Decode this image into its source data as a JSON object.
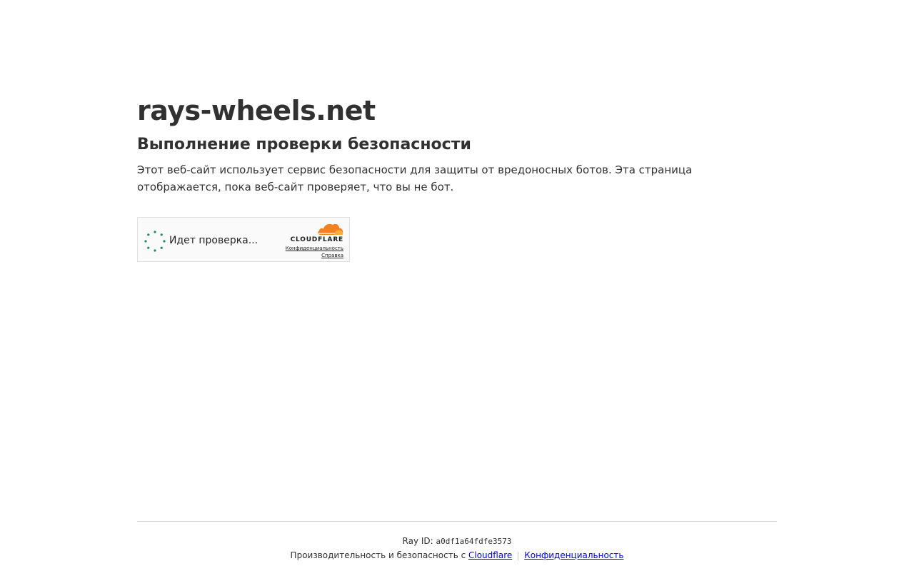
{
  "page": {
    "site_name": "rays-wheels.net",
    "heading": "Выполнение проверки безопасности",
    "description": "Этот веб-сайт использует сервис безопасности для защиты от вредоносных ботов. Эта страница отображается, пока веб-сайт проверяет, что вы не бот."
  },
  "widget": {
    "status_text": "Идет проверка...",
    "brand": "CLOUDFLARE",
    "privacy_link": "Конфиденциальность",
    "help_link": "Справка",
    "spinner_icon": "loading-spinner-icon",
    "logo_icon": "cloudflare-cloud-icon"
  },
  "footer": {
    "ray_label": "Ray ID:",
    "ray_id": "a0df1a64fdfe3573",
    "performance_text": "Производительность и безопасность с",
    "cloudflare_link": "Cloudflare",
    "privacy_link": "Конфиденциальность"
  },
  "colors": {
    "spinner": "#1e8a63",
    "cloudflare_orange": "#f48120",
    "cloudflare_light_orange": "#faad3f",
    "link": "#0000ee"
  }
}
